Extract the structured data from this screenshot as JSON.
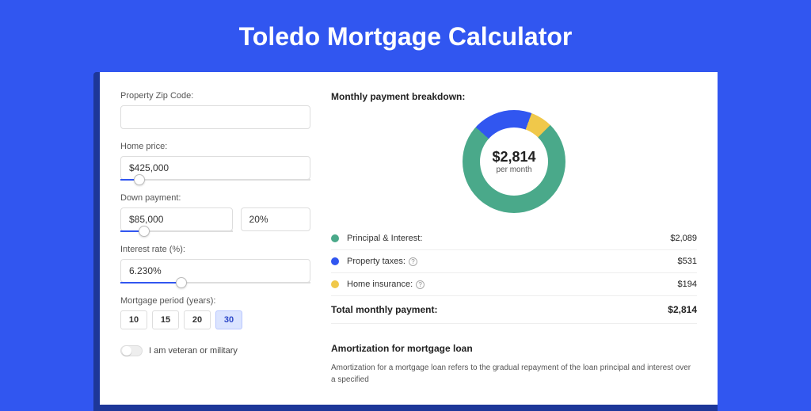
{
  "title": "Toledo Mortgage Calculator",
  "form": {
    "zip": {
      "label": "Property Zip Code:",
      "value": ""
    },
    "home_price": {
      "label": "Home price:",
      "value": "$425,000",
      "slider_pct": 10
    },
    "down_payment": {
      "label": "Down payment:",
      "amount": "$85,000",
      "pct": "20%",
      "slider_pct": 21
    },
    "interest_rate": {
      "label": "Interest rate (%):",
      "value": "6.230%",
      "slider_pct": 32
    },
    "period": {
      "label": "Mortgage period (years):",
      "options": [
        "10",
        "15",
        "20",
        "30"
      ],
      "active_index": 3
    },
    "veteran": {
      "label": "I am veteran or military",
      "on": false
    }
  },
  "breakdown": {
    "title": "Monthly payment breakdown:",
    "center_amount": "$2,814",
    "center_sub": "per month",
    "items": [
      {
        "label": "Principal & Interest:",
        "value": "$2,089",
        "color": "#4aa98a",
        "angle": 267,
        "info": false
      },
      {
        "label": "Property taxes:",
        "value": "$531",
        "color": "#3156f0",
        "angle": 68,
        "info": true
      },
      {
        "label": "Home insurance:",
        "value": "$194",
        "color": "#f0c84a",
        "angle": 25,
        "info": true
      }
    ],
    "total_label": "Total monthly payment:",
    "total_value": "$2,814"
  },
  "chart_data": {
    "type": "pie",
    "title": "Monthly payment breakdown",
    "series": [
      {
        "name": "Principal & Interest",
        "value": 2089,
        "color": "#4aa98a"
      },
      {
        "name": "Property taxes",
        "value": 531,
        "color": "#3156f0"
      },
      {
        "name": "Home insurance",
        "value": 194,
        "color": "#f0c84a"
      }
    ],
    "total": 2814,
    "center_label": "$2,814 per month"
  },
  "amortization": {
    "title": "Amortization for mortgage loan",
    "body": "Amortization for a mortgage loan refers to the gradual repayment of the loan principal and interest over a specified"
  }
}
